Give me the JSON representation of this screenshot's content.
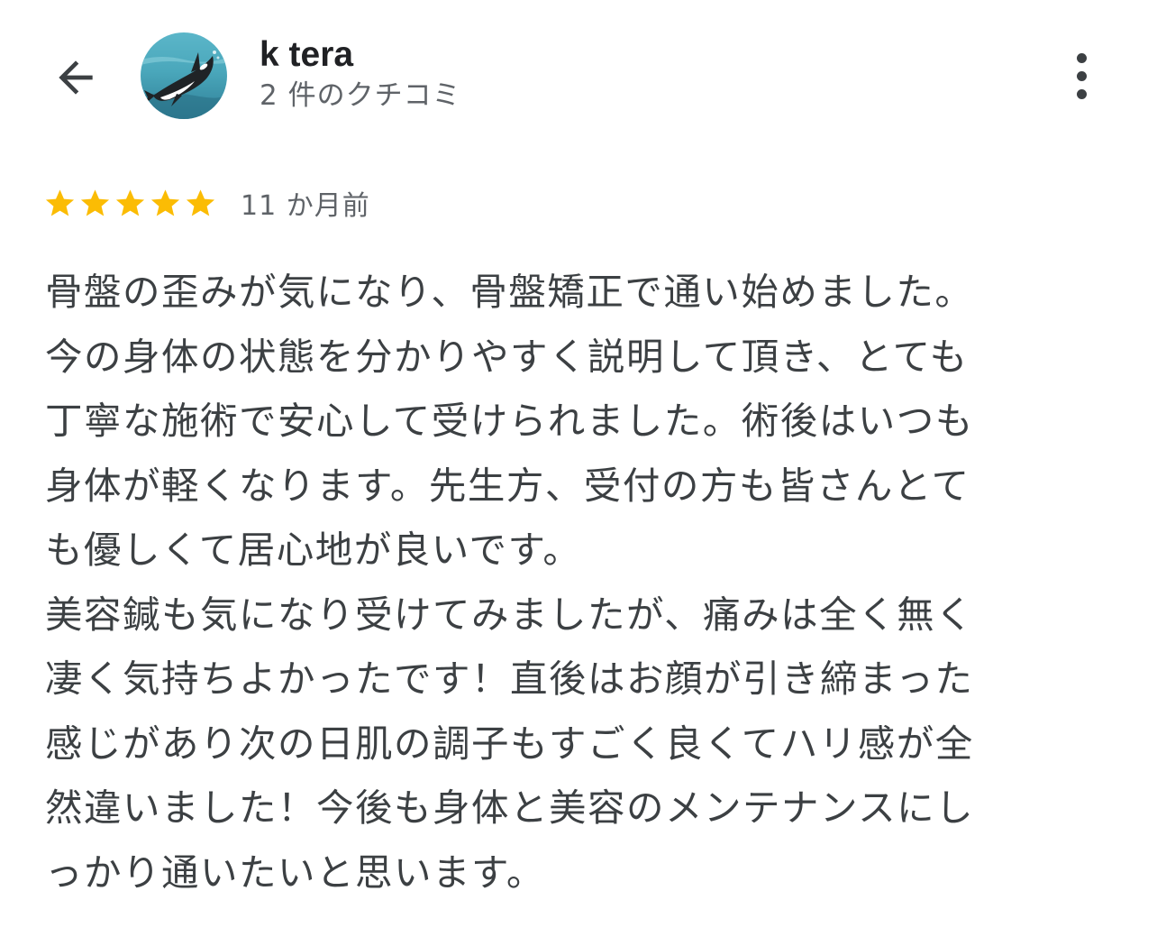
{
  "header": {
    "back_icon": "arrow-back-icon",
    "reviewer_name": "k tera",
    "review_count": "2 件のクチコミ",
    "avatar_icon": "orca-avatar",
    "more_icon": "more-vert-icon"
  },
  "review": {
    "rating": 5,
    "max_rating": 5,
    "star_color": "#fbbc04",
    "date": "11 か月前",
    "lines": [
      "骨盤の歪みが気になり、骨盤矯正で通い始めました。",
      "今の身体の状態を分かりやすく説明して頂き、とても",
      "丁寧な施術で安心して受けられました。術後はいつも",
      "身体が軽くなります。先生方、受付の方も皆さんとて",
      "も優しくて居心地が良いです。",
      "美容鍼も気になり受けてみましたが、痛みは全く無く",
      "凄く気持ちよかったです！直後はお顔が引き締まった",
      "感じがあり次の日肌の調子もすごく良くてハリ感が全",
      "然違いました！今後も身体と美容のメンテナンスにし",
      "っかり通いたいと思います。"
    ]
  }
}
